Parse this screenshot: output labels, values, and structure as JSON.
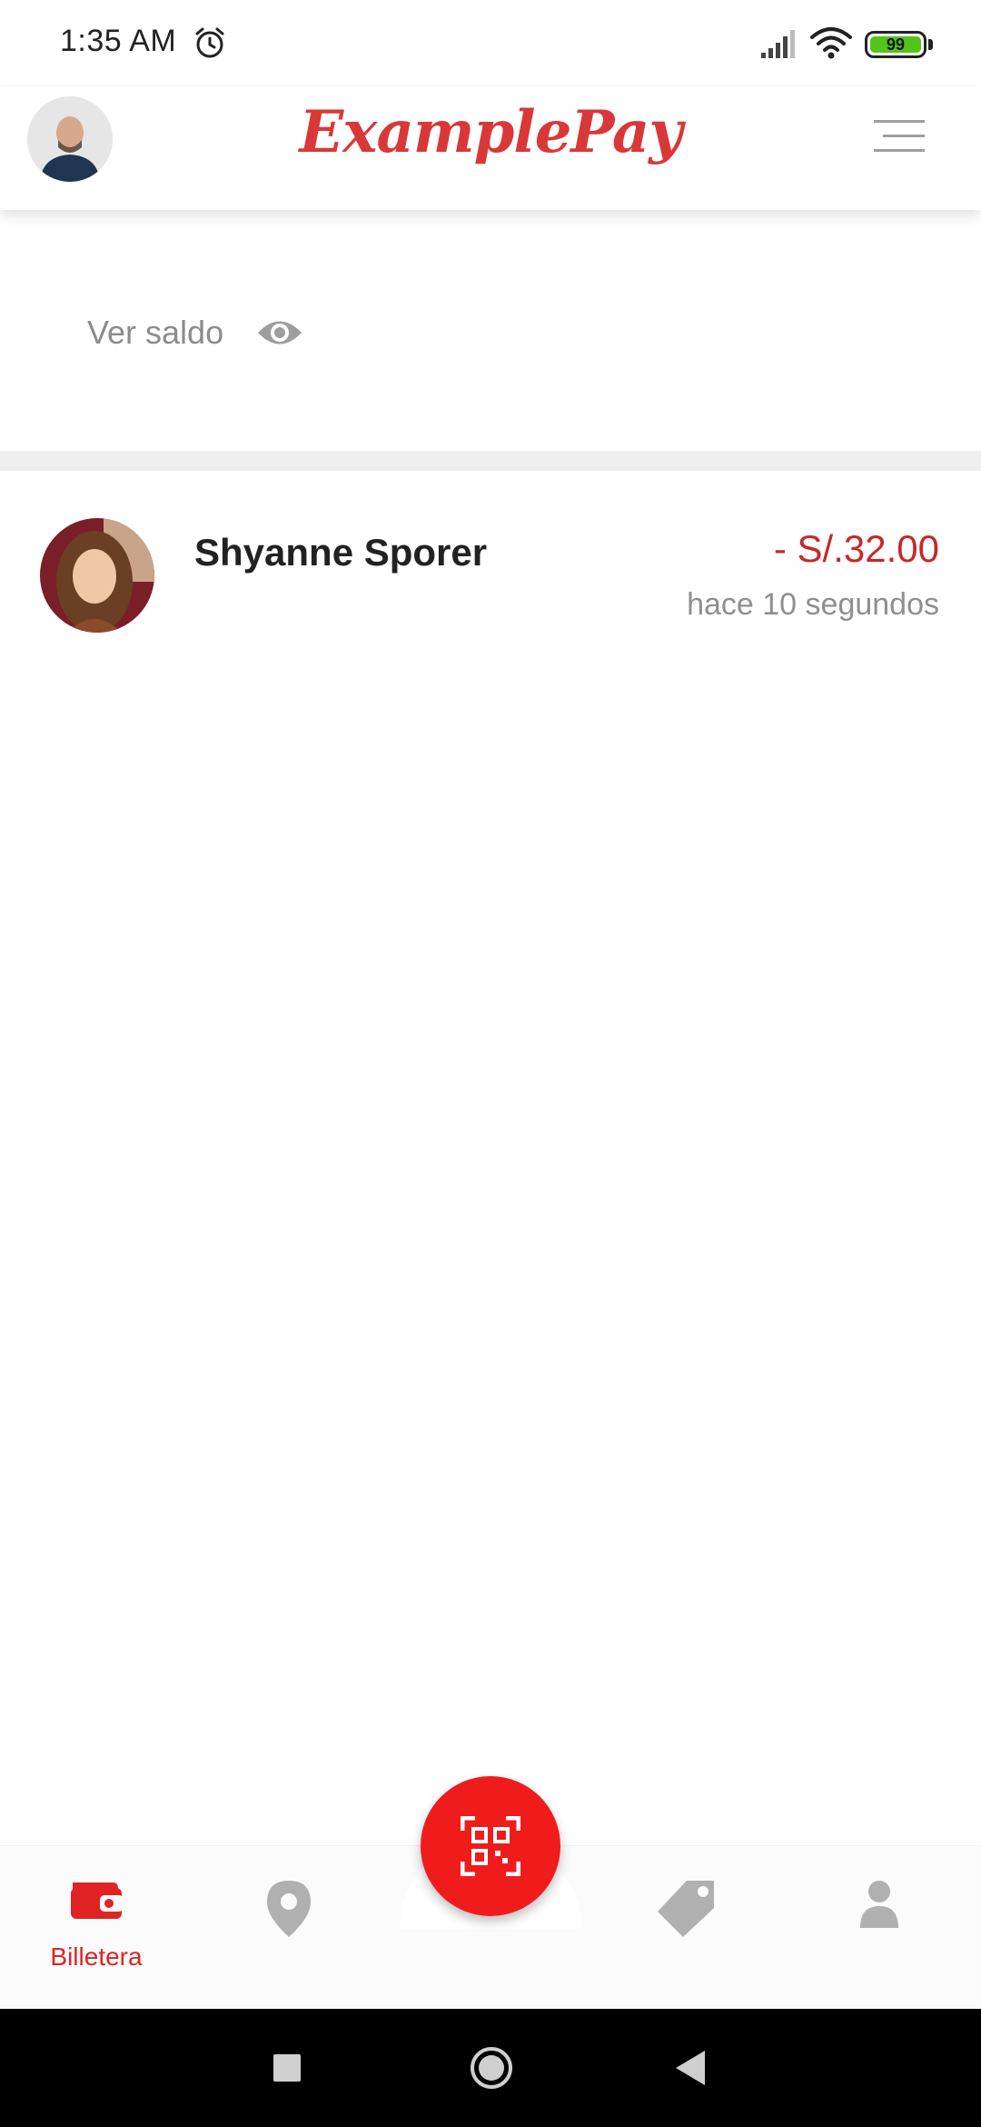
{
  "status_bar": {
    "time": "1:35 AM",
    "battery_level": "99",
    "icons": [
      "alarm-icon",
      "signal-icon",
      "wifi-icon",
      "battery-icon"
    ]
  },
  "header": {
    "app_name": "ExamplePay",
    "brand_color": "#d93838",
    "icons": [
      "user-avatar",
      "menu-icon"
    ]
  },
  "balance": {
    "label": "Ver saldo",
    "icon": "eye-icon"
  },
  "transactions": [
    {
      "name": "Shyanne Sporer",
      "amount": "- S/.32.00",
      "time": "hace 10 segundos",
      "amount_color": "#c62828"
    }
  ],
  "bottom_nav": {
    "items": [
      {
        "id": "wallet",
        "label": "Billetera",
        "icon": "wallet-icon",
        "active": true
      },
      {
        "id": "location",
        "label": "",
        "icon": "location-pin-icon",
        "active": false
      },
      {
        "id": "offers",
        "label": "",
        "icon": "tag-icon",
        "active": false
      },
      {
        "id": "profile",
        "label": "",
        "icon": "person-icon",
        "active": false
      }
    ],
    "fab_icon": "qr-scan-icon",
    "active_color": "#e02424",
    "inactive_color": "#b0b0b0"
  },
  "system_nav": {
    "icons": [
      "recents-icon",
      "home-icon",
      "back-icon"
    ]
  }
}
